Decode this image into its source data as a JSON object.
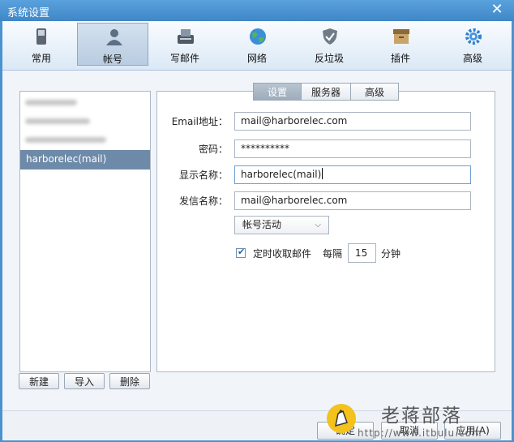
{
  "window": {
    "title": "系统设置",
    "close_symbol": "✕"
  },
  "toolbar": {
    "items": [
      {
        "label": "常用",
        "icon": "phone-icon"
      },
      {
        "label": "帐号",
        "icon": "user-icon"
      },
      {
        "label": "写邮件",
        "icon": "write-mail-icon"
      },
      {
        "label": "网络",
        "icon": "globe-icon"
      },
      {
        "label": "反垃圾",
        "icon": "shield-icon"
      },
      {
        "label": "插件",
        "icon": "plugin-box-icon"
      },
      {
        "label": "高级",
        "icon": "gear-icon"
      }
    ],
    "active": "帐号"
  },
  "accounts": {
    "items": [
      "",
      "",
      "",
      "harborelec(mail)"
    ],
    "selected": "harborelec(mail)",
    "buttons": {
      "new": "新建",
      "import": "导入",
      "delete": "删除"
    }
  },
  "tabs": {
    "items": [
      "设置",
      "服务器",
      "高级"
    ],
    "active": "设置"
  },
  "form": {
    "email_label": "Email地址：",
    "email_value": "mail@harborelec.com",
    "password_label": "密码：",
    "password_value": "**********",
    "display_name_label": "显示名称：",
    "display_name_value": "harborelec(mail)",
    "sender_name_label": "发信名称：",
    "sender_name_value": "mail@harborelec.com",
    "status_select": "帐号活动",
    "auto_fetch_label": "定时收取邮件",
    "auto_fetch_checked": true,
    "interval_prefix": "每隔",
    "interval_value": "15",
    "interval_unit": "分钟"
  },
  "footer": {
    "ok_label": "确定",
    "cancel_label": "取消",
    "apply_label": "应用(A)"
  },
  "watermark": {
    "name": "老蒋部落",
    "url": "http://www.itbulu.com"
  },
  "colors": {
    "titlebar": "#4a93cf",
    "selected_row": "#6e8aa9",
    "active_tab": "#a9b6c4"
  }
}
